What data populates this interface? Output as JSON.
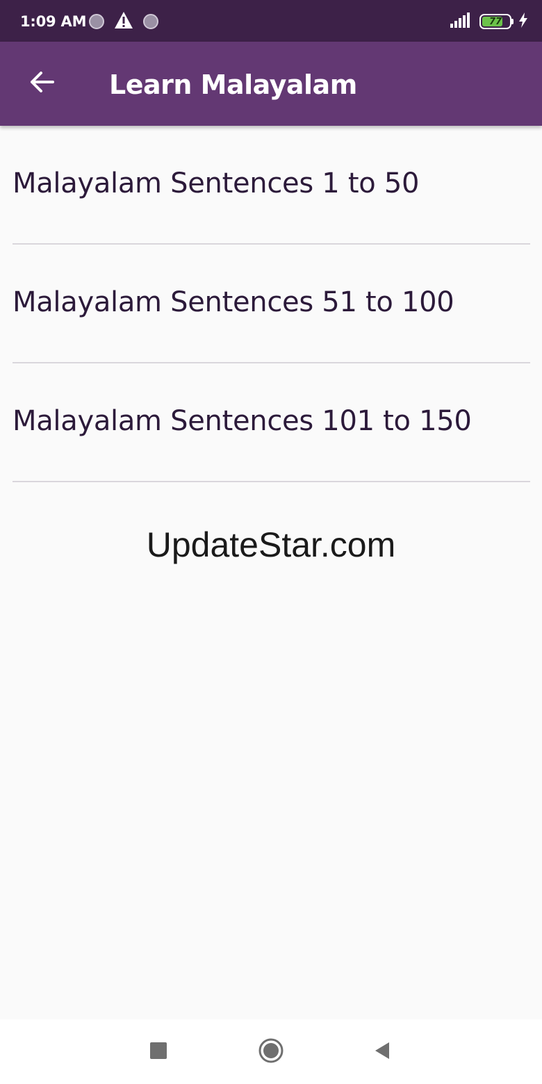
{
  "status_bar": {
    "time": "1:09 AM",
    "battery_level": "77",
    "battery_fraction": 0.77,
    "icons": [
      "notification-dot-icon",
      "warning-icon",
      "notification-dot-icon",
      "signal-icon",
      "battery-icon",
      "charging-icon"
    ]
  },
  "app_bar": {
    "title": "Learn Malayalam",
    "back_icon": "arrow-left-icon"
  },
  "menu": {
    "items": [
      {
        "label": "Malayalam Sentences 1 to 50"
      },
      {
        "label": "Malayalam Sentences 51 to 100"
      },
      {
        "label": "Malayalam Sentences 101 to 150"
      }
    ]
  },
  "watermark": {
    "text": "UpdateStar.com"
  },
  "nav_bar": {
    "icons": [
      "recents-square-icon",
      "home-circle-icon",
      "back-triangle-icon"
    ]
  },
  "colors": {
    "status_bar": "#3d2148",
    "app_bar": "#633873",
    "background": "#fafafa",
    "item_text": "#2c1a3a",
    "divider": "#d9d6dc",
    "battery_fill": "#6cc24a"
  }
}
